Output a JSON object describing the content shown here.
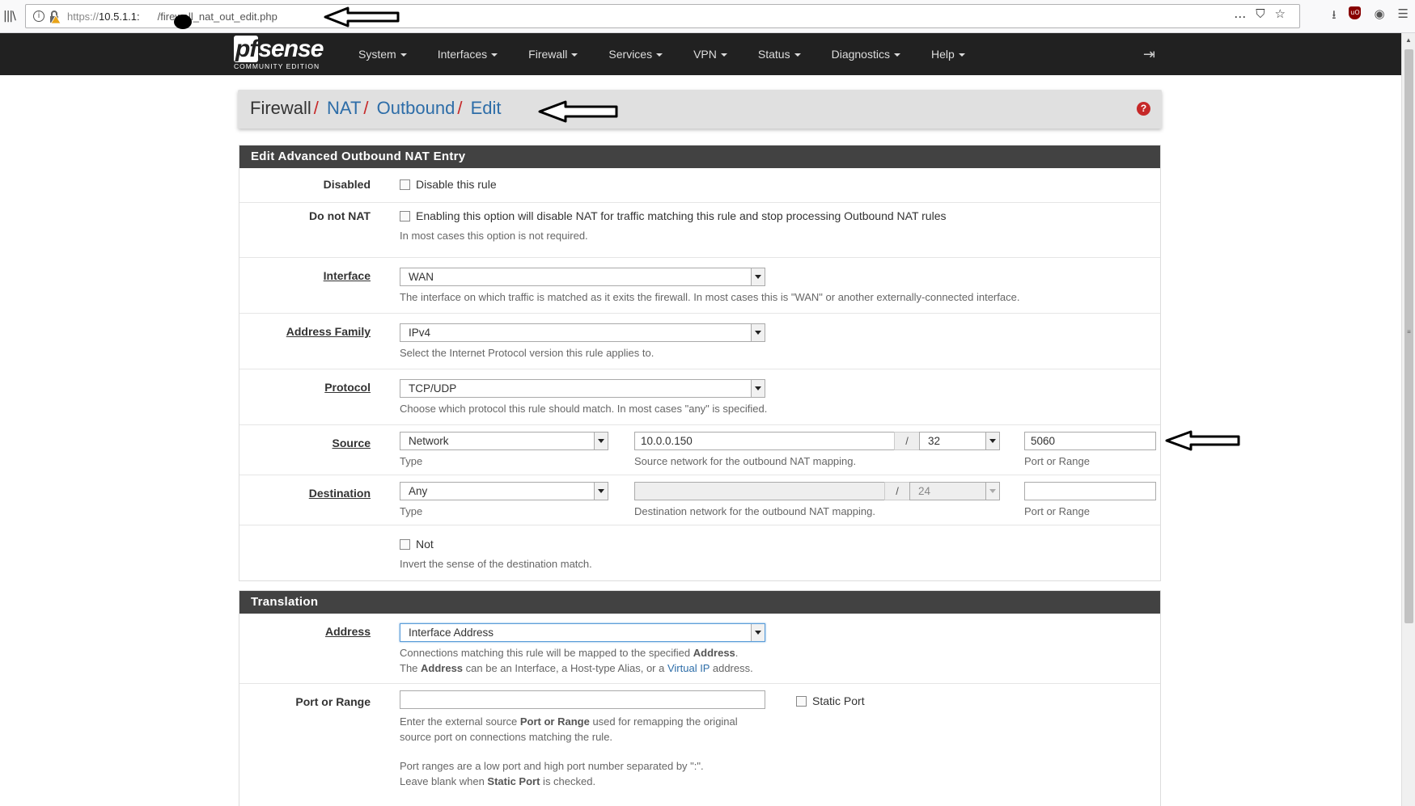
{
  "browser": {
    "url_prefix": "https://",
    "url_host": "10.5.1.1:",
    "url_path": "/firewall_nat_out_edit.php",
    "more_icon": "…",
    "star_icon": "☆"
  },
  "nav": {
    "logo_main": "sense",
    "logo_prefix": "pf",
    "logo_sub": "COMMUNITY EDITION",
    "items": [
      "System",
      "Interfaces",
      "Firewall",
      "Services",
      "VPN",
      "Status",
      "Diagnostics",
      "Help"
    ]
  },
  "breadcrumb": {
    "root": "Firewall",
    "items": [
      "NAT",
      "Outbound",
      "Edit"
    ],
    "sep": "/",
    "help": "?"
  },
  "edit_panel": {
    "title": "Edit Advanced Outbound NAT Entry",
    "disabled": {
      "label": "Disabled",
      "checkbox_text": "Disable this rule",
      "checked": false
    },
    "nonat": {
      "label": "Do not NAT",
      "checkbox_text": "Enabling this option will disable NAT for traffic matching this rule and stop processing Outbound NAT rules",
      "help": "In most cases this option is not required.",
      "checked": false
    },
    "interface": {
      "label": "Interface",
      "value": "WAN",
      "help": "The interface on which traffic is matched as it exits the firewall. In most cases this is \"WAN\" or another externally-connected interface."
    },
    "address_family": {
      "label": "Address Family",
      "value": "IPv4",
      "help": "Select the Internet Protocol version this rule applies to."
    },
    "protocol": {
      "label": "Protocol",
      "value": "TCP/UDP",
      "help": "Choose which protocol this rule should match. In most cases \"any\" is specified."
    },
    "source": {
      "label": "Source",
      "type_value": "Network",
      "type_help": "Type",
      "network": "10.0.0.150",
      "slash": "/",
      "mask": "32",
      "network_help": "Source network for the outbound NAT mapping.",
      "port": "5060",
      "port_help": "Port or Range"
    },
    "destination": {
      "label": "Destination",
      "type_value": "Any",
      "type_help": "Type",
      "network": "",
      "slash": "/",
      "mask": "24",
      "network_help": "Destination network for the outbound NAT mapping.",
      "port": "",
      "port_help": "Port or Range"
    },
    "not": {
      "checkbox_text": "Not",
      "help": "Invert the sense of the destination match.",
      "checked": false
    }
  },
  "translation_panel": {
    "title": "Translation",
    "address": {
      "label": "Address",
      "value": "Interface Address",
      "help1_a": "Connections matching this rule will be mapped to the specified ",
      "help1_b": "Address",
      "help1_c": ".",
      "help2_a": "The ",
      "help2_b": "Address",
      "help2_c": " can be an Interface, a Host-type Alias, or a ",
      "help2_link": "Virtual IP",
      "help2_d": " address."
    },
    "port": {
      "label": "Port or Range",
      "value": "",
      "static_port": "Static Port",
      "static_checked": false,
      "help1_a": "Enter the external source ",
      "help1_b": "Port or Range",
      "help1_c": " used for remapping the original",
      "help2": "source port on connections matching the rule.",
      "help3": "Port ranges are a low port and high port number separated by \":\".",
      "help4_a": "Leave blank when ",
      "help4_b": "Static Port",
      "help4_c": " is checked."
    }
  },
  "colors": {
    "navbar": "#212121",
    "panel_heading": "#424242",
    "link": "#2d6da8",
    "accent_red": "#c62828",
    "breadcrumb_bg": "#e0e0e0"
  }
}
